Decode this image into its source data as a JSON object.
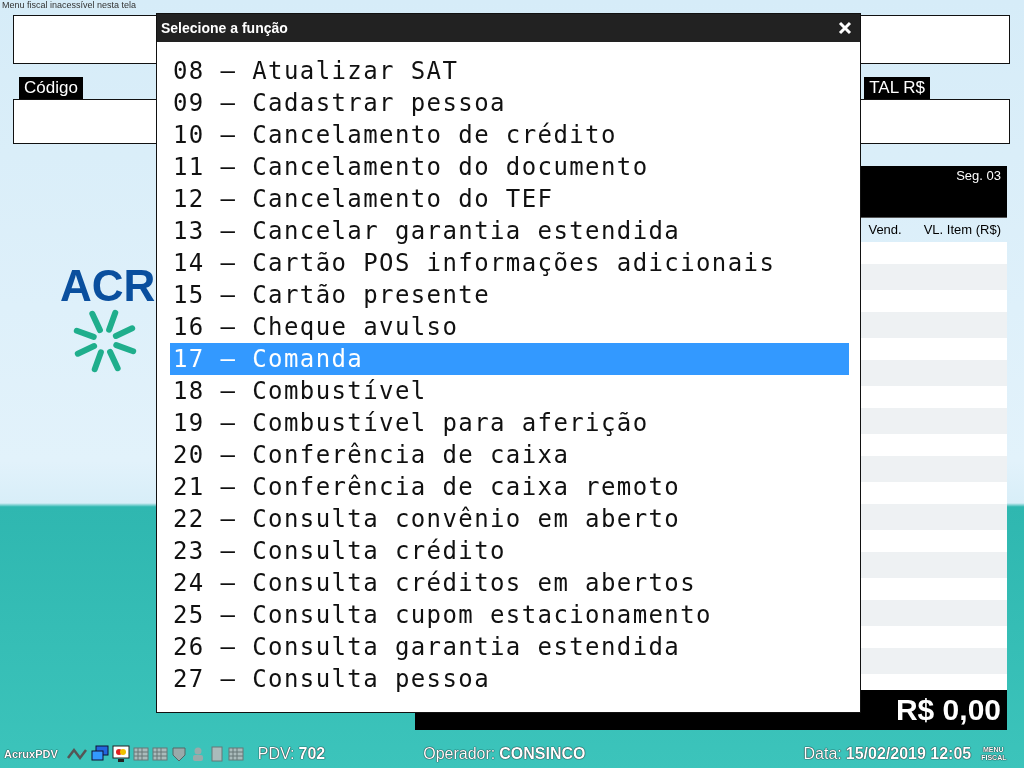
{
  "top_notice": "Menu fiscal inacessível nesta tela",
  "labels": {
    "code": "Código",
    "total": "TAL R$"
  },
  "logo": {
    "text": "ACR"
  },
  "sale_panel": {
    "segment": "Seg. 03",
    "columns": [
      "Vend.",
      "VL. Item (R$)"
    ],
    "subtotal_value": "R$ 0,00"
  },
  "dialog": {
    "title": "Selecione a função",
    "items": [
      {
        "label": "08 – Atualizar SAT",
        "selected": false
      },
      {
        "label": "09 – Cadastrar pessoa",
        "selected": false
      },
      {
        "label": "10 – Cancelamento de crédito",
        "selected": false
      },
      {
        "label": "11 – Cancelamento do documento",
        "selected": false
      },
      {
        "label": "12 – Cancelamento do TEF",
        "selected": false
      },
      {
        "label": "13 – Cancelar garantia estendida",
        "selected": false
      },
      {
        "label": "14 – Cartão POS informações adicionais",
        "selected": false
      },
      {
        "label": "15 – Cartão presente",
        "selected": false
      },
      {
        "label": "16 – Cheque avulso",
        "selected": false
      },
      {
        "label": "17 – Comanda",
        "selected": true
      },
      {
        "label": "18 – Combustível",
        "selected": false
      },
      {
        "label": "19 – Combustível para aferição",
        "selected": false
      },
      {
        "label": "20 – Conferência de caixa",
        "selected": false
      },
      {
        "label": "21 – Conferência de caixa remoto",
        "selected": false
      },
      {
        "label": "22 – Consulta convênio em aberto",
        "selected": false
      },
      {
        "label": "23 – Consulta crédito",
        "selected": false
      },
      {
        "label": "24 – Consulta créditos em abertos",
        "selected": false
      },
      {
        "label": "25 – Consulta cupom estacionamento",
        "selected": false
      },
      {
        "label": "26 – Consulta garantia estendida",
        "selected": false
      },
      {
        "label": "27 – Consulta pessoa",
        "selected": false
      }
    ]
  },
  "status_bar": {
    "app": "AcruxPDV",
    "pdv_label": "PDV:",
    "pdv": "702",
    "operator_label": "Operador:",
    "operator": "CONSINCO",
    "date_label": "Data:",
    "date": "15/02/2019 12:05",
    "menu_fiscal": "MENU FISCAL"
  }
}
